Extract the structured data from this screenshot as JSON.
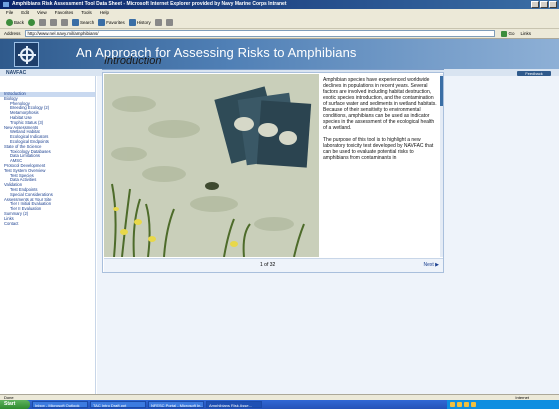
{
  "window": {
    "title": "Amphibians Risk Assessment Tool Data Sheet - Microsoft Internet Explorer provided by Navy Marine Corps Intranet"
  },
  "menu": [
    "File",
    "Edit",
    "View",
    "Favorites",
    "Tools",
    "Help"
  ],
  "toolbar": {
    "back": "Back",
    "search": "Search",
    "favorites": "Favorites",
    "history": "History"
  },
  "address": {
    "label": "Address",
    "url": "http://www.nel.navy.mil/amphibians/",
    "go": "Go",
    "links": "Links"
  },
  "banner": {
    "title": "An Approach for Assessing Risks to Amphibians",
    "org": "NAVFAC",
    "feedback": "Feedback"
  },
  "sidebar": {
    "items": [
      {
        "label": "Introduction",
        "level": 0,
        "active": true
      },
      {
        "label": "Biology",
        "level": 0
      },
      {
        "label": "Phenology",
        "level": 1
      },
      {
        "label": "Breeding Ecology (2)",
        "level": 1
      },
      {
        "label": "Metamorphosis",
        "level": 1
      },
      {
        "label": "Habitat Use",
        "level": 1
      },
      {
        "label": "Trophic Status (3)",
        "level": 1
      },
      {
        "label": "New Assessments",
        "level": 0
      },
      {
        "label": "Wetland Habitat",
        "level": 1
      },
      {
        "label": "Ecological Indicators",
        "level": 1
      },
      {
        "label": "Ecological Endpoints",
        "level": 1
      },
      {
        "label": "State of the Science",
        "level": 0
      },
      {
        "label": "Toxicology Databases",
        "level": 1
      },
      {
        "label": "Data Limitations",
        "level": 1
      },
      {
        "label": "AMSC",
        "level": 1
      },
      {
        "label": "Protocol Development",
        "level": 0
      },
      {
        "label": "Test System Overview",
        "level": 0
      },
      {
        "label": "Test Species",
        "level": 1
      },
      {
        "label": "Data Activities",
        "level": 1
      },
      {
        "label": "Validation",
        "level": 0
      },
      {
        "label": "Test Endpoints",
        "level": 1
      },
      {
        "label": "Special Considerations",
        "level": 1
      },
      {
        "label": "Assessments at Your Site",
        "level": 0
      },
      {
        "label": "Tier I Initial Evaluation",
        "level": 1
      },
      {
        "label": "Tier II Evaluation",
        "level": 1
      },
      {
        "label": "Summary (2)",
        "level": 0
      },
      {
        "label": "Links",
        "level": 0
      },
      {
        "label": "Contact",
        "level": 0
      }
    ]
  },
  "main": {
    "title": "Introduction",
    "paragraph1": "Amphibian species have experienced worldwide declines in populations in recent years.  Several factors are involved including habitat destruction, exotic species introduction, and the contamination of surface water and sediments in wetland habitats. Because of their sensitivity to environmental conditions, amphibians can be used as indicator species in the assessment of the ecological health of a wetland.",
    "paragraph2": "The purpose of this tool is to highlight a new laboratory toxicity test developed by NAVFAC that can be used to evaluate potential risks to amphibians from contaminants in",
    "page_counter": "1  of 32",
    "next": "Next ▶"
  },
  "statusbar": {
    "left": "Done",
    "zone": "Internet"
  },
  "taskbar": {
    "start": "Start",
    "tasks": [
      {
        "label": "Inbox - Microsoft Outlook"
      },
      {
        "label": "TAC Intro Draft.ppt"
      },
      {
        "label": "NFESC Portal - Microsoft In..."
      },
      {
        "label": "Amphibians Risk Asse...",
        "active": true
      }
    ]
  }
}
